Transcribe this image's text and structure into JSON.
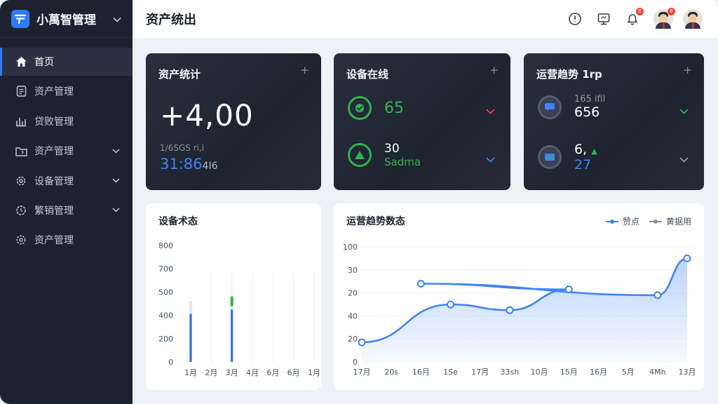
{
  "app": {
    "name": "小萬智管理"
  },
  "sidebar": {
    "items": [
      {
        "label": "首页",
        "icon": "home-icon",
        "active": true
      },
      {
        "label": "资产管理",
        "icon": "document-icon"
      },
      {
        "label": "贷败管理",
        "icon": "bar-chart-icon"
      },
      {
        "label": "资产管理",
        "icon": "folder-icon",
        "expandable": true
      },
      {
        "label": "设备管理",
        "icon": "gear-icon",
        "expandable": true
      },
      {
        "label": "繁销管理",
        "icon": "clock-gear-icon",
        "expandable": true
      },
      {
        "label": "资产管理",
        "icon": "settings-icon"
      }
    ]
  },
  "header": {
    "title": "资产统出",
    "notification_count": "8",
    "avatar_badge": "8",
    "icons": [
      "info-icon",
      "monitor-icon",
      "bell-icon"
    ]
  },
  "cards": {
    "asset_stats": {
      "title": "资产统计",
      "value": "+4,00",
      "sub_label": "1/6SGS ri,l",
      "sub_value": "31:86",
      "sub_value_suffix": "4I6"
    },
    "device_online": {
      "title": "设备在线",
      "row1": {
        "value": "65"
      },
      "row2": {
        "value": "30",
        "label": "Sadma"
      }
    },
    "ops_trend": {
      "title": "运营趋势 1rp",
      "row1": {
        "faded": "165 ifil",
        "value": "656"
      },
      "row2": {
        "value": "6,",
        "sub": "27"
      }
    },
    "plus_symbol": "+"
  },
  "device_status_chart": {
    "title": "设备术态",
    "chart_data": {
      "type": "bar",
      "categories": [
        "1月",
        "2月",
        "3月",
        "4月",
        "6月",
        "6月",
        "1月"
      ],
      "yticks": [
        "800",
        "700",
        "500",
        "400",
        "200",
        "0"
      ],
      "series": [
        {
          "values": [
            420,
            0,
            450,
            0,
            0,
            0,
            0
          ]
        },
        {
          "values": [
            330,
            0,
            360,
            0,
            0,
            0,
            0
          ]
        }
      ],
      "ylim": [
        0,
        800
      ]
    }
  },
  "ops_chart": {
    "title": "运营趋势数态",
    "legend": [
      {
        "name": "赞点"
      },
      {
        "name": "黄据用"
      }
    ],
    "chart_data": {
      "type": "area",
      "x": [
        "17月",
        "20s",
        "16月",
        "1Se",
        "17月",
        "33sh",
        "10月",
        "15月",
        "16月",
        "5月",
        "4Mh",
        "13月"
      ],
      "yticks": [
        "100",
        "30",
        "20",
        "40",
        "20",
        "0"
      ],
      "points": [
        {
          "x": "17月",
          "y": 17
        },
        {
          "x": "1Se",
          "y": 50
        },
        {
          "x": "33sh",
          "y": 45
        },
        {
          "x": "15月",
          "y": 63
        },
        {
          "x": "16月",
          "y": 68
        },
        {
          "x": "4Mh",
          "y": 58
        },
        {
          "x": "13月",
          "y": 90
        }
      ],
      "ylim": [
        0,
        100
      ],
      "color": "#3d82f7"
    }
  },
  "colors": {
    "accent": "#2f7cf6",
    "green": "#2fb34d",
    "red": "#f04438",
    "sidebar": "#1d2230"
  }
}
